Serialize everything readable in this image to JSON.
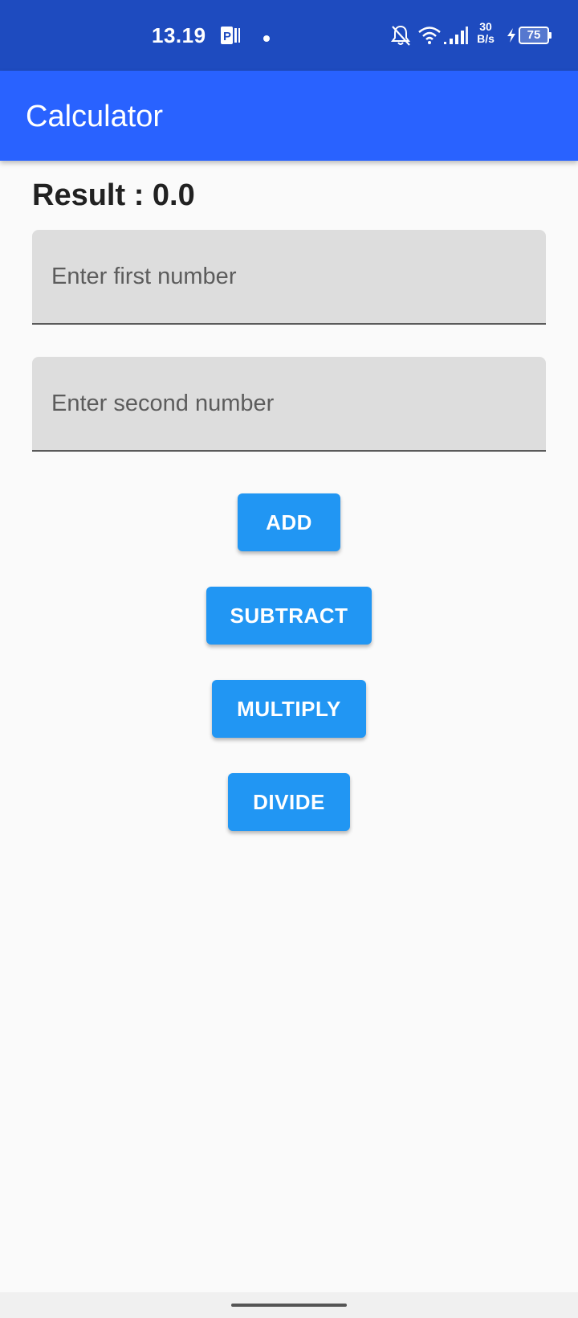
{
  "status_bar": {
    "time": "13.19",
    "network_speed_value": "30",
    "network_speed_unit": "B/s",
    "battery_level": "75",
    "icons": [
      "parking-icon",
      "dot-icon",
      "bell-off-icon",
      "wifi-icon",
      "signal-icon",
      "charging-icon",
      "battery-icon"
    ]
  },
  "app_bar": {
    "title": "Calculator",
    "color": "#2962ff"
  },
  "main": {
    "result_text": "Result : 0.0",
    "first_input": {
      "placeholder": "Enter first number",
      "value": ""
    },
    "second_input": {
      "placeholder": "Enter second number",
      "value": ""
    },
    "buttons": {
      "add": "ADD",
      "subtract": "SUBTRACT",
      "multiply": "MULTIPLY",
      "divide": "DIVIDE"
    },
    "button_color": "#2196f3"
  }
}
